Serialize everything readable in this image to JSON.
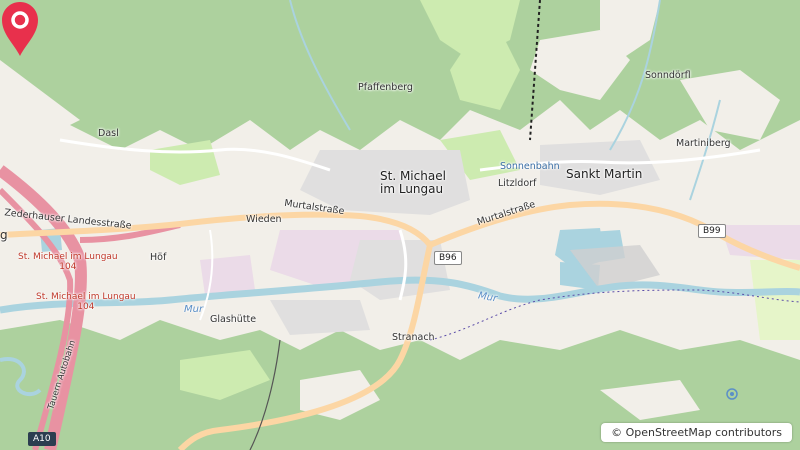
{
  "map": {
    "places": {
      "pfaffenberg": "Pfaffenberg",
      "sonndoerfl": "Sonndörfl",
      "dasl": "Dasl",
      "martiniberg": "Martiniberg",
      "st_michael": "St. Michael\nim Lungau",
      "sankt_martin": "Sankt Martin",
      "litzldorf": "Litzldorf",
      "wieden": "Wieden",
      "hof": "Höf",
      "glashuette": "Glashütte",
      "stranach": "Stranach",
      "sonnenbahn": "Sonnenbahn"
    },
    "roads": {
      "murtalstrasse_1": "Murtalstraße",
      "murtalstrasse_2": "Murtalstraße",
      "zederhauser": "Zederhauser Landesstraße",
      "exit_104_a": "St. Michael im Lungau\n104",
      "exit_104_b": "St. Michael im Lungau\n104",
      "tauern": "Tauern Autobahn"
    },
    "rivers": {
      "mur_west": "Mur",
      "mur_east": "Mur"
    },
    "shields": {
      "b96": "B96",
      "b99": "B99",
      "a10": "A10"
    },
    "fragment_left": "g"
  },
  "attribution": "© OpenStreetMap contributors",
  "colors": {
    "forest": "#add19e",
    "meadow": "#cdebb0",
    "background": "#f2efe9",
    "residential": "#e0dfdf",
    "industrial": "#ebdbe8",
    "water": "#aad3df",
    "primary_road": "#fcd6a4",
    "motorway": "#e892a2",
    "marker": "#e8304c"
  }
}
